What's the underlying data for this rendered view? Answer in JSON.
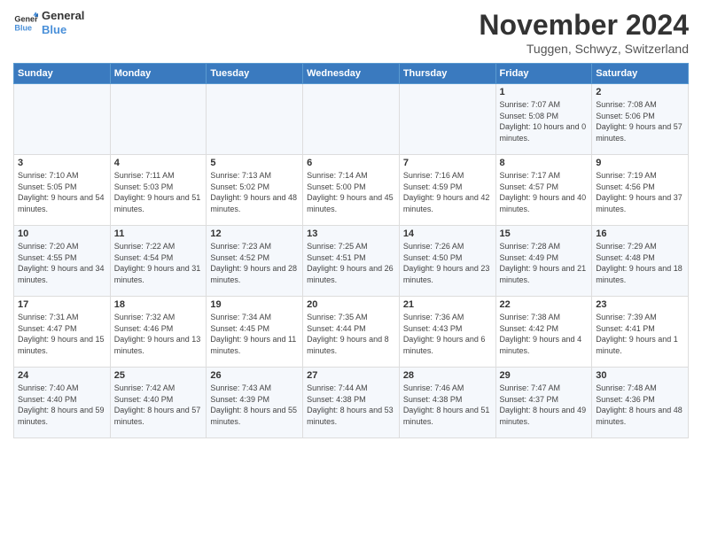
{
  "logo": {
    "line1": "General",
    "line2": "Blue"
  },
  "title": "November 2024",
  "location": "Tuggen, Schwyz, Switzerland",
  "weekdays": [
    "Sunday",
    "Monday",
    "Tuesday",
    "Wednesday",
    "Thursday",
    "Friday",
    "Saturday"
  ],
  "weeks": [
    [
      {
        "day": "",
        "info": ""
      },
      {
        "day": "",
        "info": ""
      },
      {
        "day": "",
        "info": ""
      },
      {
        "day": "",
        "info": ""
      },
      {
        "day": "",
        "info": ""
      },
      {
        "day": "1",
        "info": "Sunrise: 7:07 AM\nSunset: 5:08 PM\nDaylight: 10 hours and 0 minutes."
      },
      {
        "day": "2",
        "info": "Sunrise: 7:08 AM\nSunset: 5:06 PM\nDaylight: 9 hours and 57 minutes."
      }
    ],
    [
      {
        "day": "3",
        "info": "Sunrise: 7:10 AM\nSunset: 5:05 PM\nDaylight: 9 hours and 54 minutes."
      },
      {
        "day": "4",
        "info": "Sunrise: 7:11 AM\nSunset: 5:03 PM\nDaylight: 9 hours and 51 minutes."
      },
      {
        "day": "5",
        "info": "Sunrise: 7:13 AM\nSunset: 5:02 PM\nDaylight: 9 hours and 48 minutes."
      },
      {
        "day": "6",
        "info": "Sunrise: 7:14 AM\nSunset: 5:00 PM\nDaylight: 9 hours and 45 minutes."
      },
      {
        "day": "7",
        "info": "Sunrise: 7:16 AM\nSunset: 4:59 PM\nDaylight: 9 hours and 42 minutes."
      },
      {
        "day": "8",
        "info": "Sunrise: 7:17 AM\nSunset: 4:57 PM\nDaylight: 9 hours and 40 minutes."
      },
      {
        "day": "9",
        "info": "Sunrise: 7:19 AM\nSunset: 4:56 PM\nDaylight: 9 hours and 37 minutes."
      }
    ],
    [
      {
        "day": "10",
        "info": "Sunrise: 7:20 AM\nSunset: 4:55 PM\nDaylight: 9 hours and 34 minutes."
      },
      {
        "day": "11",
        "info": "Sunrise: 7:22 AM\nSunset: 4:54 PM\nDaylight: 9 hours and 31 minutes."
      },
      {
        "day": "12",
        "info": "Sunrise: 7:23 AM\nSunset: 4:52 PM\nDaylight: 9 hours and 28 minutes."
      },
      {
        "day": "13",
        "info": "Sunrise: 7:25 AM\nSunset: 4:51 PM\nDaylight: 9 hours and 26 minutes."
      },
      {
        "day": "14",
        "info": "Sunrise: 7:26 AM\nSunset: 4:50 PM\nDaylight: 9 hours and 23 minutes."
      },
      {
        "day": "15",
        "info": "Sunrise: 7:28 AM\nSunset: 4:49 PM\nDaylight: 9 hours and 21 minutes."
      },
      {
        "day": "16",
        "info": "Sunrise: 7:29 AM\nSunset: 4:48 PM\nDaylight: 9 hours and 18 minutes."
      }
    ],
    [
      {
        "day": "17",
        "info": "Sunrise: 7:31 AM\nSunset: 4:47 PM\nDaylight: 9 hours and 15 minutes."
      },
      {
        "day": "18",
        "info": "Sunrise: 7:32 AM\nSunset: 4:46 PM\nDaylight: 9 hours and 13 minutes."
      },
      {
        "day": "19",
        "info": "Sunrise: 7:34 AM\nSunset: 4:45 PM\nDaylight: 9 hours and 11 minutes."
      },
      {
        "day": "20",
        "info": "Sunrise: 7:35 AM\nSunset: 4:44 PM\nDaylight: 9 hours and 8 minutes."
      },
      {
        "day": "21",
        "info": "Sunrise: 7:36 AM\nSunset: 4:43 PM\nDaylight: 9 hours and 6 minutes."
      },
      {
        "day": "22",
        "info": "Sunrise: 7:38 AM\nSunset: 4:42 PM\nDaylight: 9 hours and 4 minutes."
      },
      {
        "day": "23",
        "info": "Sunrise: 7:39 AM\nSunset: 4:41 PM\nDaylight: 9 hours and 1 minute."
      }
    ],
    [
      {
        "day": "24",
        "info": "Sunrise: 7:40 AM\nSunset: 4:40 PM\nDaylight: 8 hours and 59 minutes."
      },
      {
        "day": "25",
        "info": "Sunrise: 7:42 AM\nSunset: 4:40 PM\nDaylight: 8 hours and 57 minutes."
      },
      {
        "day": "26",
        "info": "Sunrise: 7:43 AM\nSunset: 4:39 PM\nDaylight: 8 hours and 55 minutes."
      },
      {
        "day": "27",
        "info": "Sunrise: 7:44 AM\nSunset: 4:38 PM\nDaylight: 8 hours and 53 minutes."
      },
      {
        "day": "28",
        "info": "Sunrise: 7:46 AM\nSunset: 4:38 PM\nDaylight: 8 hours and 51 minutes."
      },
      {
        "day": "29",
        "info": "Sunrise: 7:47 AM\nSunset: 4:37 PM\nDaylight: 8 hours and 49 minutes."
      },
      {
        "day": "30",
        "info": "Sunrise: 7:48 AM\nSunset: 4:36 PM\nDaylight: 8 hours and 48 minutes."
      }
    ]
  ]
}
